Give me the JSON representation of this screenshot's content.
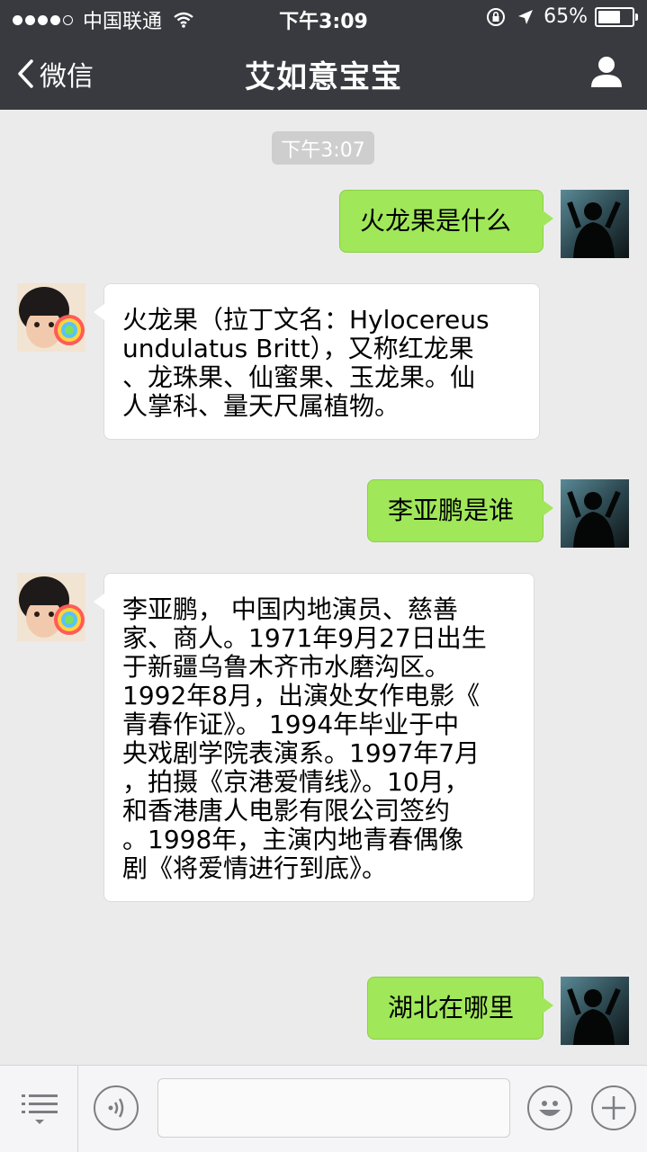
{
  "status_bar": {
    "carrier": "中国联通",
    "time": "下午3:09",
    "battery": "65%"
  },
  "nav": {
    "back_label": "微信",
    "title": "艾如意宝宝"
  },
  "chat": {
    "timestamp": "下午3:07",
    "messages": [
      {
        "from": "me",
        "text": "火龙果是什么"
      },
      {
        "from": "bot",
        "lines": [
          "火龙果（拉丁文名：Hylocereus",
          "undulatus Britt），又称红龙果",
          "、龙珠果、仙蜜果、玉龙果。仙",
          "人掌科、量天尺属植物。"
        ]
      },
      {
        "from": "me",
        "text": "李亚鹏是谁"
      },
      {
        "from": "bot",
        "lines": [
          "李亚鹏， 中国内地演员、慈善",
          "家、商人。1971年9月27日出生",
          "于新疆乌鲁木齐市水磨沟区。",
          "1992年8月，出演处女作电影《",
          "青春作证》。 1994年毕业于中",
          "央戏剧学院表演系。1997年7月",
          "，拍摄《京港爱情线》。10月，",
          "和香港唐人电影有限公司签约",
          "。1998年，主演内地青春偶像",
          "剧《将爱情进行到底》。"
        ]
      },
      {
        "from": "me",
        "text": "湖北在哪里"
      }
    ]
  },
  "input_bar": {
    "text_value": "",
    "icons": [
      "list-icon",
      "voice-icon",
      "emoji-icon",
      "plus-icon"
    ]
  },
  "colors": {
    "nav_bg": "#393a3f",
    "chat_bg": "#ebebeb",
    "outgoing_bubble": "#a0e759",
    "incoming_bubble": "#ffffff"
  }
}
